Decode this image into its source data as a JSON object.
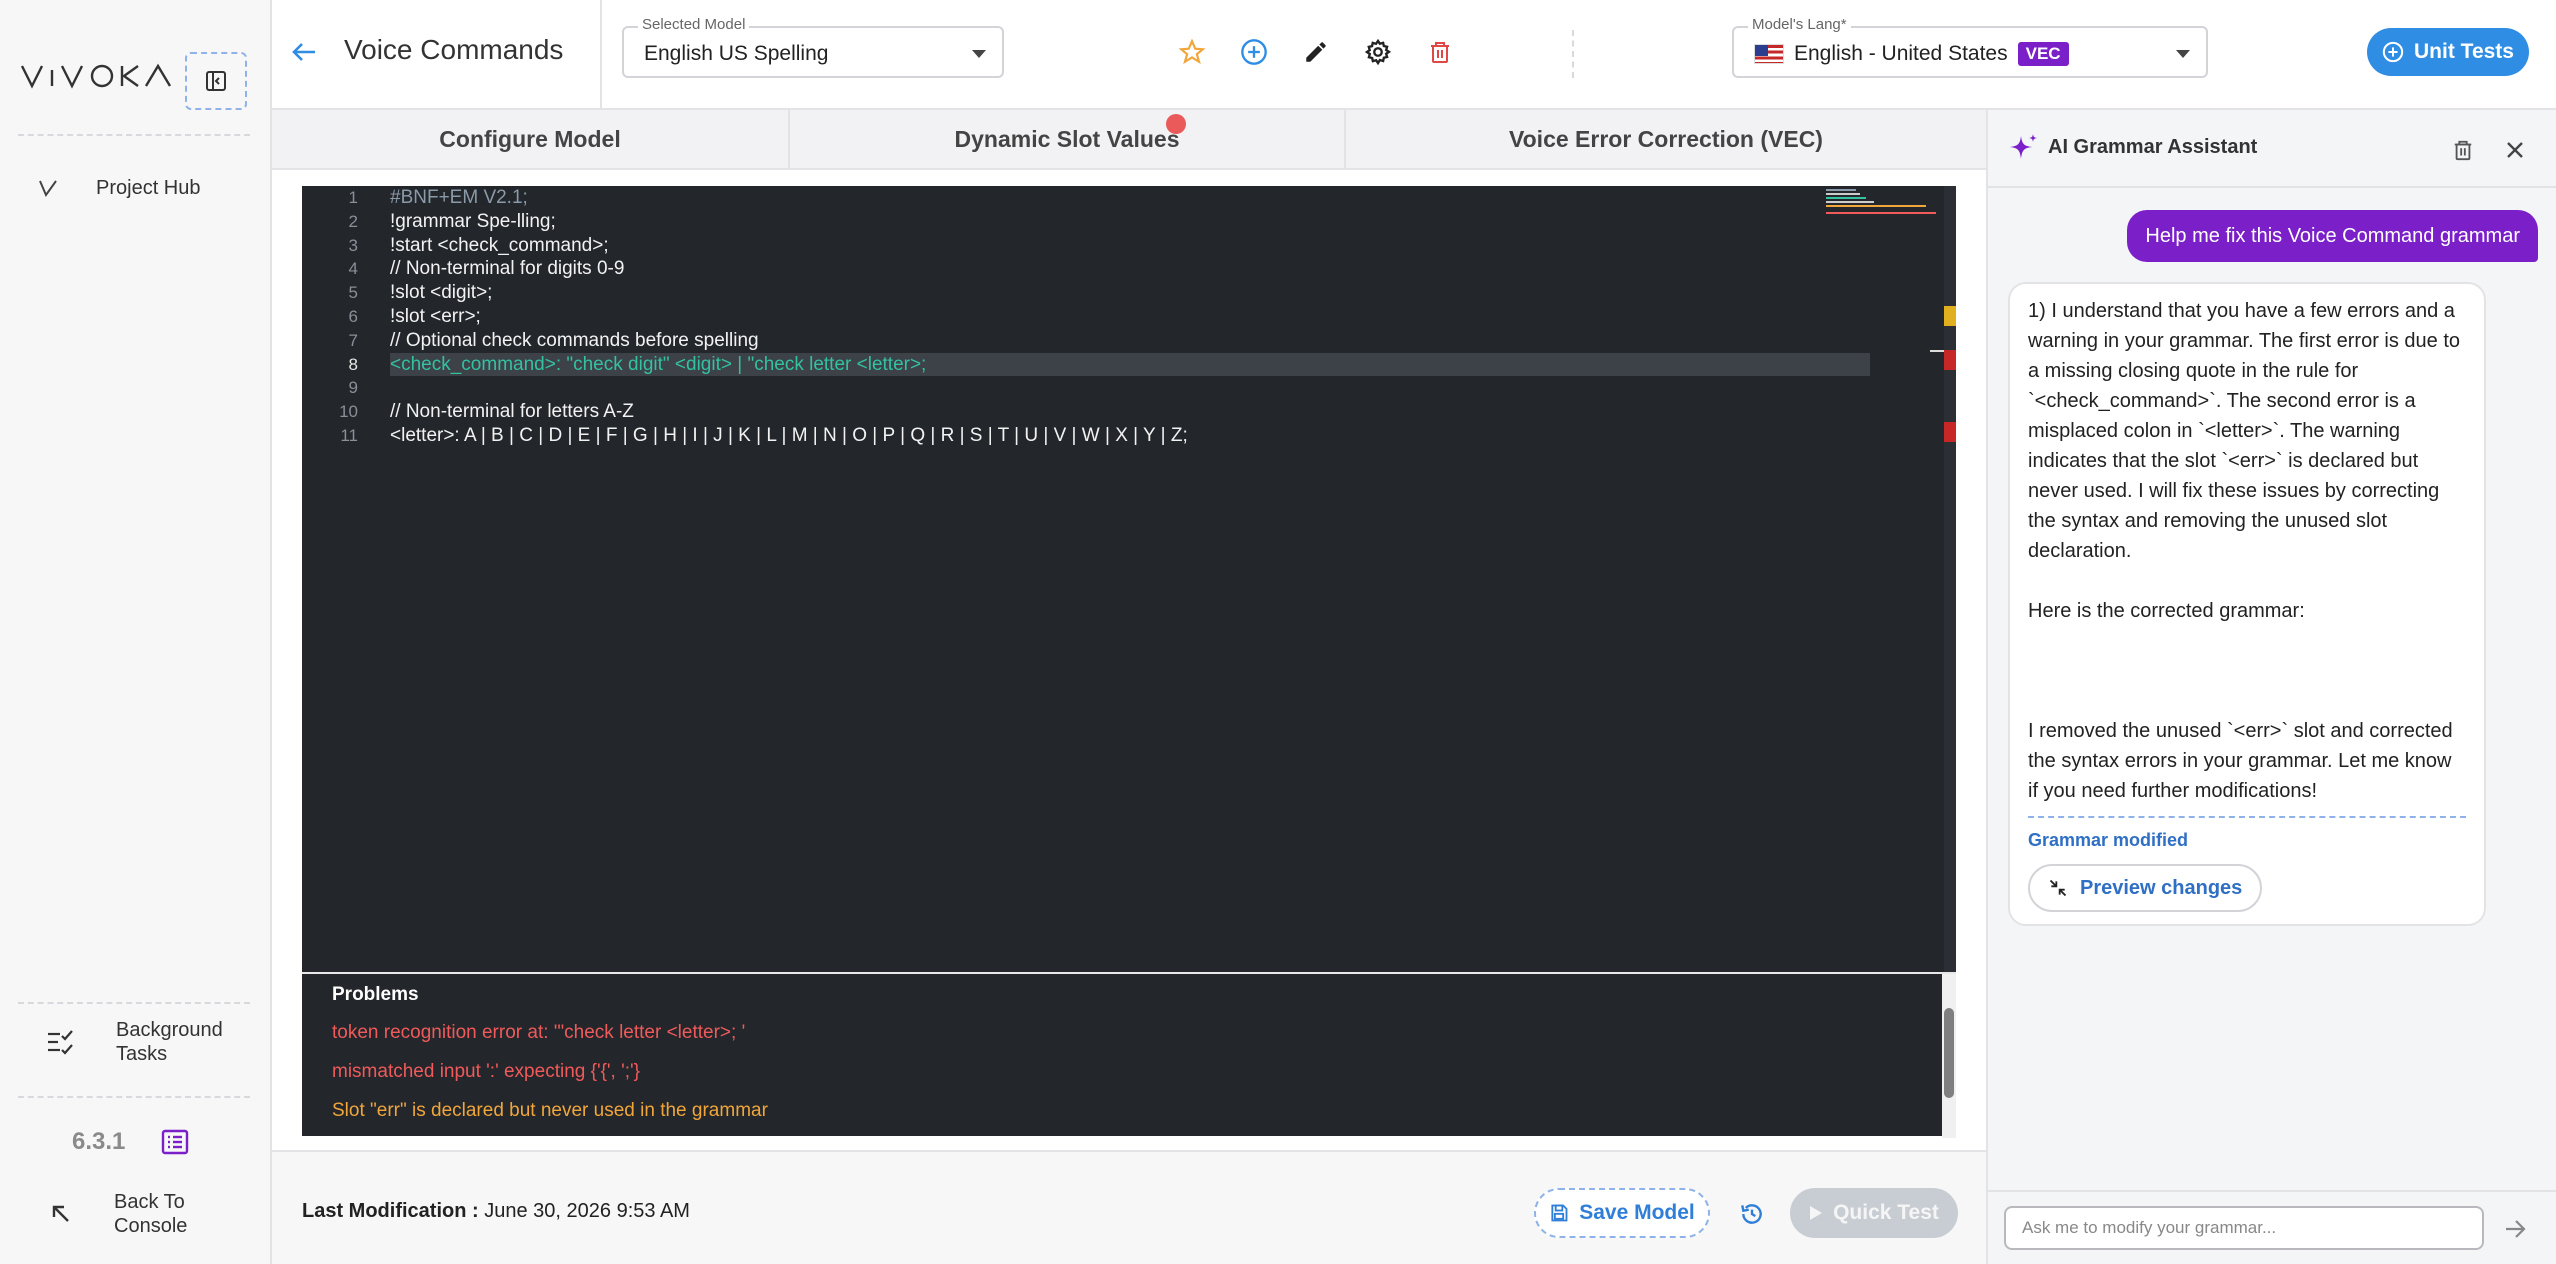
{
  "sidebar": {
    "project_hub": "Project Hub",
    "background_tasks": "Background Tasks",
    "version": "6.3.1",
    "back_to_console": "Back To Console"
  },
  "header": {
    "title": "Voice Commands",
    "selected_model_label": "Selected Model",
    "selected_model_value": "English US Spelling",
    "model_lang_label": "Model's Lang*",
    "model_lang_value": "English - United States",
    "vec_badge": "VEC",
    "unit_tests_label": "Unit Tests"
  },
  "tabs": [
    {
      "label": "Configure Model",
      "active": true
    },
    {
      "label": "Dynamic Slot Values",
      "active": false,
      "has_alert_dot": true
    },
    {
      "label": "Voice Error Correction (VEC)",
      "active": false
    }
  ],
  "editor": {
    "lines": [
      "#BNF+EM V2.1;",
      "!grammar Spe-lling;",
      "!start <check_command>;",
      "// Non-terminal for digits 0-9",
      "!slot <digit>;",
      "!slot <err>;",
      "// Optional check commands before spelling",
      "<check_command>: \"check digit\" <digit> | \"check letter <letter>;",
      "",
      "// Non-terminal for letters A-Z",
      "<letter>: A | B | C | D | E | F | G | H | I | J | K | L | M | N | O | P | Q | R | S | T | U | V | W | X | Y | Z;"
    ],
    "current_line": 8
  },
  "problems": {
    "title": "Problems",
    "items": [
      {
        "severity": "error",
        "text": "token recognition error at: '\"check letter <letter>; '"
      },
      {
        "severity": "error",
        "text": "mismatched input ':' expecting {'{', ';'}"
      },
      {
        "severity": "warning",
        "text": "Slot \"err\" is declared but never used in the grammar"
      }
    ]
  },
  "footer": {
    "last_mod_label": "Last Modification :",
    "last_mod_value": "June 30, 2026 9:53 AM",
    "save_label": "Save Model",
    "quick_test_label": "Quick Test"
  },
  "ai": {
    "title": "AI Grammar Assistant",
    "user_message": "Help me fix this Voice Command grammar",
    "bot_message": "1) I understand that you have a few errors and a warning in your grammar. The first error is due to a missing closing quote in the rule for `<check_command>`. The second error is a misplaced colon in `<letter>`. The warning indicates that the slot `<err>` is declared but never used. I will fix these issues by correcting the syntax and removing the unused slot declaration.\n\nHere is the corrected grammar:\n\n\n\nI removed the unused `<err>` slot and corrected the syntax errors in your grammar. Let me know if you need further modifications!",
    "grammar_modified": "Grammar modified",
    "preview_label": "Preview changes",
    "input_placeholder": "Ask me to modify your grammar..."
  },
  "colors": {
    "accent_blue": "#2f8de4",
    "accent_purple": "#7b1fc9",
    "error_red": "#f05a5a",
    "warning_orange": "#f0a63a",
    "editor_bg": "#23262b"
  }
}
